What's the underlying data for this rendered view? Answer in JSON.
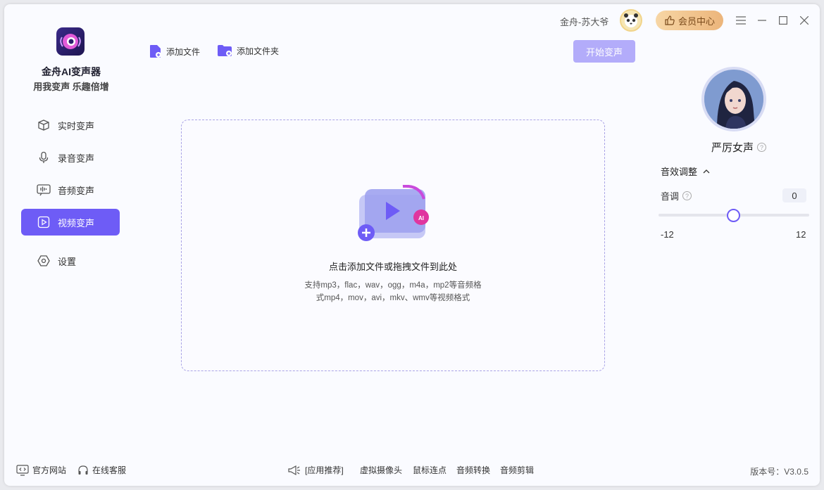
{
  "app": {
    "name": "金舟AI变声器",
    "slogan": "用我变声 乐趣倍增"
  },
  "sidebar": {
    "items": [
      {
        "label": "实时变声",
        "icon": "cube-icon",
        "active": false
      },
      {
        "label": "录音变声",
        "icon": "microphone-icon",
        "active": false
      },
      {
        "label": "音频变声",
        "icon": "audio-wave-icon",
        "active": false
      },
      {
        "label": "视频变声",
        "icon": "video-play-icon",
        "active": true
      },
      {
        "label": "设置",
        "icon": "settings-hexagon-icon",
        "active": false
      }
    ]
  },
  "toolbar": {
    "add_file": "添加文件",
    "add_folder": "添加文件夹",
    "start": "开始变声"
  },
  "dropzone": {
    "title": "点击添加文件或拖拽文件到此处",
    "hint_line1": "支持mp3，flac，wav，ogg，m4a，mp2等音频格",
    "hint_line2": "式mp4，mov，avi，mkv、wmv等视频格式"
  },
  "titlebar": {
    "user_name": "金舟-苏大爷",
    "vip": "会员中心"
  },
  "voice_panel": {
    "voice_name": "严厉女声",
    "effect_title": "音效调整",
    "pitch_label": "音调",
    "pitch_value": "0",
    "pitch_min": "-12",
    "pitch_max": "12",
    "pitch_level": 0
  },
  "footer": {
    "website": "官方网站",
    "support": "在线客服",
    "recommend": "[应用推荐]",
    "apps": [
      "虚拟摄像头",
      "鼠标连点",
      "音频转换",
      "音频剪辑"
    ],
    "version": "版本号：V3.0.5"
  },
  "colors": {
    "accent": "#6e5cf6",
    "start_disabled": "#b3acfa",
    "vip_gold": "#ecb57b"
  }
}
